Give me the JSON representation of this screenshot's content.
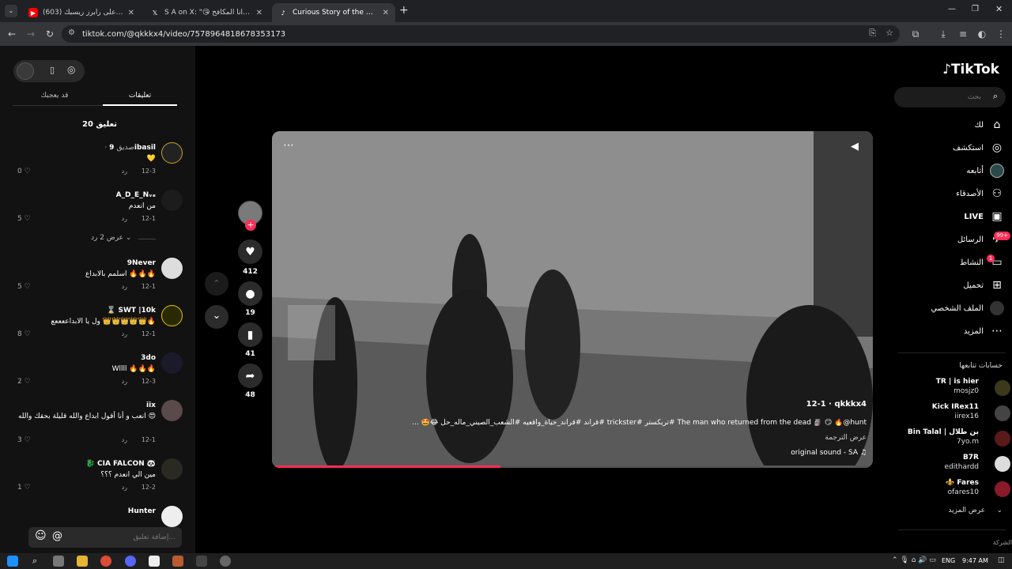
{
  "browser": {
    "tabs": [
      {
        "title": "(603) دس تراك على رابرز ريسبك...",
        "favicon": "youtube-icon",
        "color": "#ff0000"
      },
      {
        "title": "S A on X: \"😘 أنا المكافح ❤️🔥 ...\"",
        "favicon": "x-icon",
        "color": "#ffffff"
      },
      {
        "title": "Curious Story of the Man W",
        "favicon": "tiktok-icon",
        "color": "#ffffff"
      }
    ],
    "new_tab": "+",
    "url": "tiktok.com/@qkkkx4/video/7578964818678353173"
  },
  "sidebar": {
    "logo": "TikTok",
    "search_placeholder": "بحث",
    "items": [
      {
        "label": "لك",
        "icon": "home-icon"
      },
      {
        "label": "استكشف",
        "icon": "compass-icon"
      },
      {
        "label": "أتابعه",
        "icon": "following-icon"
      },
      {
        "label": "الأصدقاء",
        "icon": "friends-icon"
      },
      {
        "label": "LIVE",
        "icon": "live-icon"
      },
      {
        "label": "الرسائل",
        "icon": "messages-icon",
        "badge": "99+"
      },
      {
        "label": "النشاط",
        "icon": "activity-icon",
        "badge": "1"
      },
      {
        "label": "تحميل",
        "icon": "upload-icon"
      },
      {
        "label": "الملف الشخصي",
        "icon": "profile-icon"
      },
      {
        "label": "المزيد",
        "icon": "more-icon"
      }
    ],
    "following_title": "حسابات تتابعها",
    "following": [
      {
        "name": "TR | is hier",
        "user": "mosjz0"
      },
      {
        "name": "Kick IRex11",
        "user": "iirex16"
      },
      {
        "name": "Bin Talal | بن طلال",
        "user": "7yo.m"
      },
      {
        "name": "B7R",
        "user": "edithardd"
      },
      {
        "name": "⚜️ Fares",
        "user": "ofares10"
      }
    ],
    "see_more": "عرض المزيد",
    "company": "الشركة"
  },
  "comments_panel": {
    "tabs": [
      "تعليقات",
      "قد يعجبك"
    ],
    "count_label": "20 تعليق",
    "reply_label": "رد",
    "comments": [
      {
        "name": "9ibasil",
        "tag": "· صديق",
        "text": "💛",
        "date": "12-3",
        "likes": "0"
      },
      {
        "name": "A_D_E_Nᵥₑ",
        "tag": "",
        "text": "من انعدم",
        "date": "12-1",
        "likes": "5",
        "view_replies": "عرض 2 رد"
      },
      {
        "name": "9Never",
        "tag": "",
        "text": "اسلمم بالابداع 🔥🔥🔥",
        "date": "12-1",
        "likes": "5"
      },
      {
        "name": "⌛ SWT |10k",
        "tag": "",
        "text": "ول يا الابداععععع 👑👑👑👑👑🔥",
        "date": "12-1",
        "likes": "8"
      },
      {
        "name": "3do",
        "tag": "",
        "text": "Wllll 🔥🔥🔥",
        "date": "12-3",
        "likes": "2"
      },
      {
        "name": "iix",
        "tag": "",
        "text": "انعب و أنا أقول ابداع والله قليلة بحقك والله 😍",
        "date": "12-1",
        "likes": "3"
      },
      {
        "name": "🐉 CIA FALCON 🐼",
        "tag": "",
        "text": "مين الي انعدم ؟؟؟",
        "date": "12-2",
        "likes": "1"
      },
      {
        "name": "Hunter",
        "tag": "",
        "text": "",
        "date": "",
        "likes": ""
      }
    ],
    "input_placeholder": "إضافة تعليق..."
  },
  "video": {
    "author": "qkkkx4",
    "date": "12-1",
    "caption": "The man who returned from the dead 🗿 😏 🔥@hunt #تريكستر #trickster #قراند #قراند_حياة_واقعيه #الشعب_الصيني_ماله_حل 😂🤩 ...",
    "translate": "عرض الترجمة",
    "sound": "original sound - SA",
    "progress": 0.38
  },
  "actions": {
    "likes": "412",
    "comments": "19",
    "saves": "41",
    "shares": "48"
  },
  "taskbar": {
    "lang": "ENG",
    "time": "9:47 AM"
  }
}
